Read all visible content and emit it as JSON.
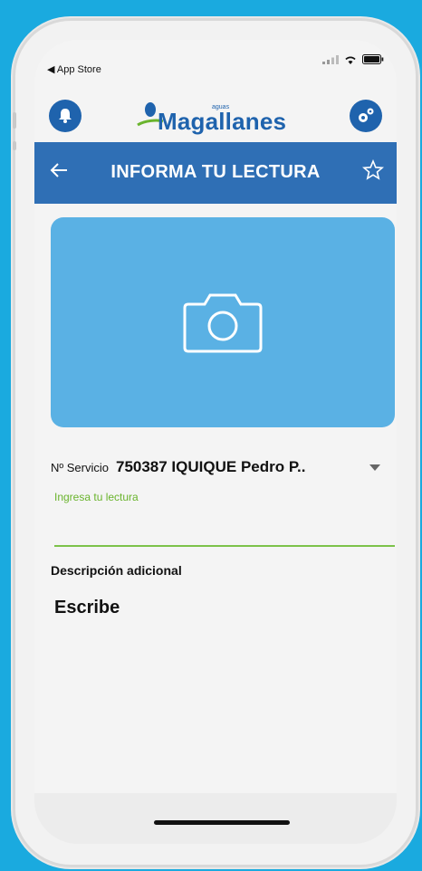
{
  "status_bar": {
    "back_app": "◀ App Store"
  },
  "header": {
    "logo_sub": "aguas",
    "logo_text": "Magallanes"
  },
  "navbar": {
    "title": "INFORMA TU LECTURA"
  },
  "form": {
    "service_label": "Nº Servicio",
    "service_value": "750387 IQUIQUE Pedro P..",
    "reading_label": "Ingresa tu lectura",
    "reading_value": "",
    "description_label": "Descripción adicional",
    "description_placeholder": "Escribe"
  },
  "colors": {
    "background": "#1aaadf",
    "brand_blue": "#1f63ad",
    "navbar": "#2f6fb5",
    "photo_area": "#5ab1e4",
    "accent_green": "#7cc24a"
  }
}
